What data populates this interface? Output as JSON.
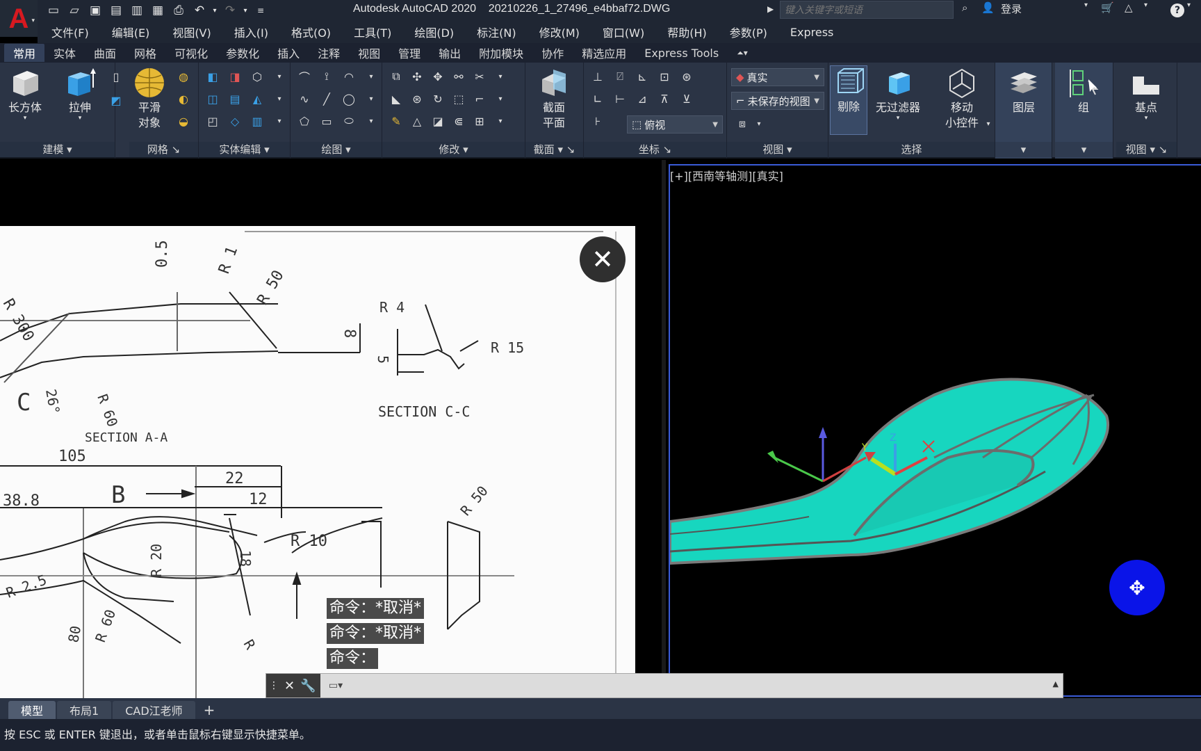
{
  "title_bar": {
    "title": "Autodesk AutoCAD 2020    20210226_1_27496_e4bbaf72.DWG",
    "search_placeholder": "键入关键字或短语",
    "login_label": "登录",
    "help_label": "?"
  },
  "menu": [
    "文件(F)",
    "编辑(E)",
    "视图(V)",
    "插入(I)",
    "格式(O)",
    "工具(T)",
    "绘图(D)",
    "标注(N)",
    "修改(M)",
    "窗口(W)",
    "帮助(H)",
    "参数(P)",
    "Express"
  ],
  "ribbon_tabs": [
    "常用",
    "实体",
    "曲面",
    "网格",
    "可视化",
    "参数化",
    "插入",
    "注释",
    "视图",
    "管理",
    "输出",
    "附加模块",
    "协作",
    "精选应用",
    "Express Tools"
  ],
  "ribbon": {
    "modeling": {
      "title": "建模",
      "box_label": "长方体",
      "extrude_label": "拉伸"
    },
    "mesh": {
      "title": "网格",
      "smooth_label_1": "平滑",
      "smooth_label_2": "对象"
    },
    "solid_edit": {
      "title": "实体编辑"
    },
    "draw": {
      "title": "绘图"
    },
    "modify": {
      "title": "修改"
    },
    "section": {
      "title": "截面",
      "plane_label_1": "截面",
      "plane_label_2": "平面"
    },
    "coordinates": {
      "title": "坐标",
      "view_select": "俯视"
    },
    "view": {
      "title": "视图",
      "visual_style": "真实",
      "saved_view": "未保存的视图"
    },
    "selection": {
      "title": "选择",
      "cull_label": "剔除",
      "no_filter_label": "无过滤器",
      "gizmo_label_1": "移动",
      "gizmo_label_2": "小控件"
    },
    "layers": {
      "label": "图层"
    },
    "groups": {
      "label": "组"
    },
    "view2": {
      "title": "视图",
      "base_label": "基点"
    }
  },
  "viewport": {
    "label": "[+][西南等轴测][真实]"
  },
  "command_history": [
    "命令：*取消*",
    "命令：*取消*",
    "命令："
  ],
  "command_line": {
    "placeholder": ""
  },
  "layout_tabs": [
    "模型",
    "布局1",
    "CAD江老师"
  ],
  "status_text": "按 ESC 或 ENTER 键退出，或者单击鼠标右键显示快捷菜单。",
  "drawing_annotations": {
    "r300": "R 300",
    "d05": "0.5",
    "r1": "R 1",
    "r50a": "R 50",
    "d8": "8",
    "r4": "R 4",
    "r15": "R 15",
    "d5": "5",
    "section_cc": "SECTION  C-C",
    "c_label": "C",
    "d26": "26°",
    "r60a": "R 60",
    "section_aa": "SECTION A-A",
    "d105": "105",
    "b_label": "B",
    "d22": "22",
    "d12": "12",
    "d388": "38.8",
    "r20": "R 20",
    "d18": "18",
    "r10": "R 10",
    "r25": "R 2.5",
    "r50b": "R 50",
    "d80": "80",
    "r60b": "R 60",
    "r_small": "R"
  },
  "colors": {
    "spoon": "#17d6bf",
    "viewport_border": "#3a5bd8",
    "nav_wheel": "#0a14e8",
    "logo_red": "#d71920"
  }
}
